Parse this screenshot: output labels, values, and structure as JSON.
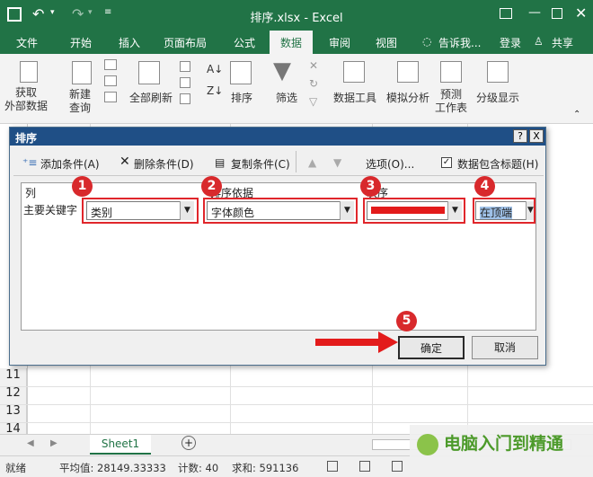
{
  "app": {
    "title": "排序.xlsx - Excel",
    "share": "共享",
    "login": "登录",
    "tellme": "告诉我..."
  },
  "menu": [
    "文件",
    "开始",
    "插入",
    "页面布局",
    "公式",
    "数据",
    "审阅",
    "视图"
  ],
  "ribbon": {
    "get_data": "获取\n外部数据",
    "new_query": "新建\n查询",
    "refresh": "全部刷新",
    "sort": "排序",
    "filter": "筛选",
    "data_tools": "数据工具",
    "what_if": "模拟分析",
    "forecast": "预测\n工作表",
    "outline": "分级显示"
  },
  "dialog": {
    "title": "排序",
    "help": "?",
    "close": "X",
    "toolbar": {
      "add": "添加条件(A)",
      "delete": "删除条件(D)",
      "copy": "复制条件(C)",
      "options": "选项(O)...",
      "header": "数据包含标题(H)"
    },
    "headers": {
      "col": "列",
      "sort_on": "排序依据",
      "order": "次序"
    },
    "row": {
      "label": "主要关键字",
      "column": "类别",
      "sort_on": "字体颜色",
      "order_pos": "在顶端"
    },
    "ok": "确定",
    "cancel": "取消",
    "order_color": "#e31b1b"
  },
  "markers": [
    "1",
    "2",
    "3",
    "4",
    "5"
  ],
  "rows": [
    "11",
    "12",
    "13",
    "14"
  ],
  "sheet_tab": "Sheet1",
  "status": {
    "ready": "就绪",
    "avg": "平均值: 28149.33333",
    "count": "计数: 40",
    "sum": "求和: 591136"
  },
  "watermark": "电脑入门到精通"
}
